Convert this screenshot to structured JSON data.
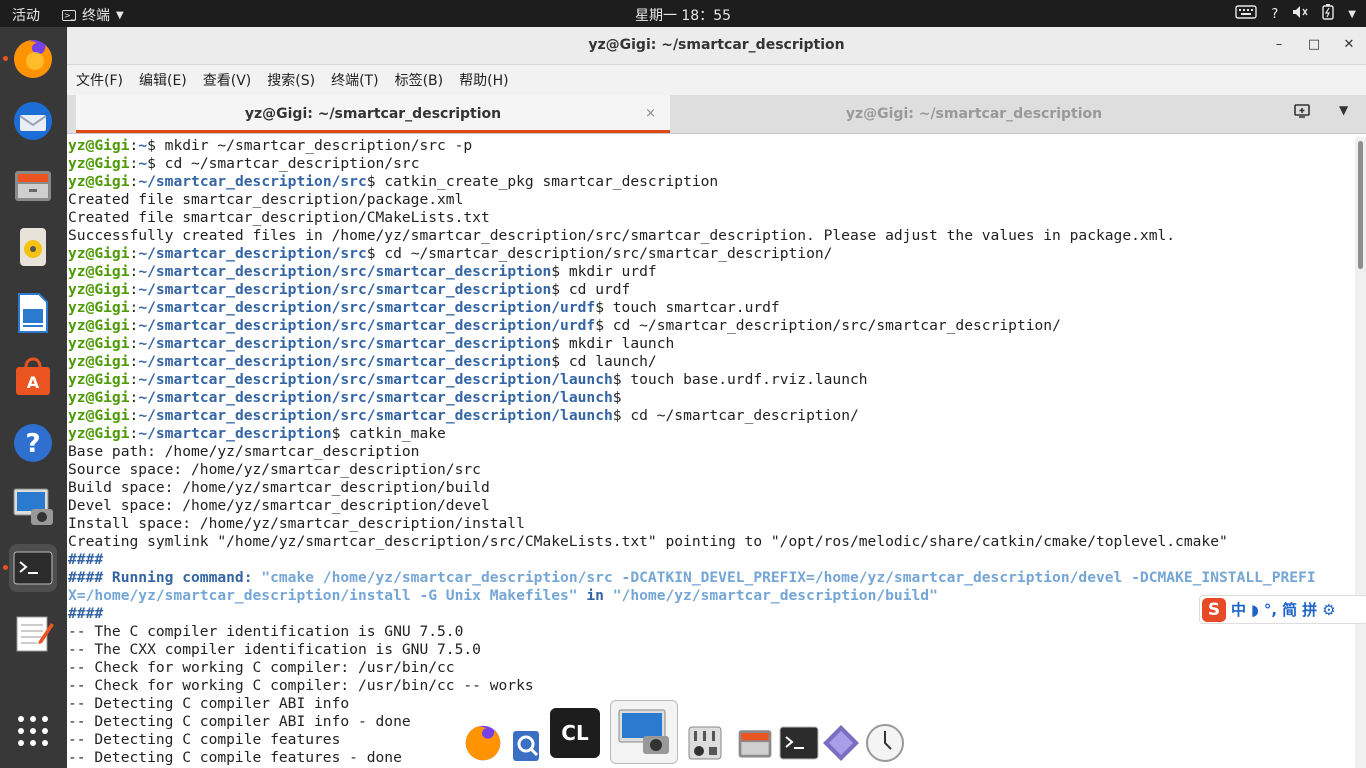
{
  "topbar": {
    "activities": "活动",
    "app_menu": "终端",
    "clock": "星期一 18：55",
    "tray": {
      "help": "?"
    }
  },
  "window": {
    "title": "yz@Gigi: ~/smartcar_description",
    "minimize": "–",
    "maximize": "□",
    "close": "✕"
  },
  "menubar": [
    "文件(F)",
    "编辑(E)",
    "查看(V)",
    "搜索(S)",
    "终端(T)",
    "标签(B)",
    "帮助(H)"
  ],
  "tabs": [
    {
      "label": "yz@Gigi: ~/smartcar_description",
      "close": "×"
    },
    {
      "label": "yz@Gigi: ~/smartcar_description",
      "close": "×"
    }
  ],
  "terminal": {
    "user": "yz@Gigi",
    "lines": [
      {
        "path": "~",
        "cmd": "mkdir ~/smartcar_description/src -p"
      },
      {
        "path": "~",
        "cmd": "cd ~/smartcar_description/src"
      },
      {
        "path": "~/smartcar_description/src",
        "cmd": "catkin_create_pkg smartcar_description"
      },
      {
        "text": "Created file smartcar_description/package.xml"
      },
      {
        "text": "Created file smartcar_description/CMakeLists.txt"
      },
      {
        "text": "Successfully created files in /home/yz/smartcar_description/src/smartcar_description. Please adjust the values in package.xml."
      },
      {
        "path": "~/smartcar_description/src",
        "cmd": "cd ~/smartcar_description/src/smartcar_description/"
      },
      {
        "path": "~/smartcar_description/src/smartcar_description",
        "cmd": "mkdir urdf"
      },
      {
        "path": "~/smartcar_description/src/smartcar_description",
        "cmd": "cd urdf"
      },
      {
        "path": "~/smartcar_description/src/smartcar_description/urdf",
        "cmd": "touch smartcar.urdf"
      },
      {
        "path": "~/smartcar_description/src/smartcar_description/urdf",
        "cmd": "cd ~/smartcar_description/src/smartcar_description/"
      },
      {
        "path": "~/smartcar_description/src/smartcar_description",
        "cmd": "mkdir launch"
      },
      {
        "path": "~/smartcar_description/src/smartcar_description",
        "cmd": "cd launch/"
      },
      {
        "path": "~/smartcar_description/src/smartcar_description/launch",
        "cmd": "touch base.urdf.rviz.launch"
      },
      {
        "path": "~/smartcar_description/src/smartcar_description/launch",
        "cmd": ""
      },
      {
        "path": "~/smartcar_description/src/smartcar_description/launch",
        "cmd": "cd ~/smartcar_description/"
      },
      {
        "path": "~/smartcar_description",
        "cmd": "catkin_make"
      },
      {
        "text": "Base path: /home/yz/smartcar_description"
      },
      {
        "text": "Source space: /home/yz/smartcar_description/src"
      },
      {
        "text": "Build space: /home/yz/smartcar_description/build"
      },
      {
        "text": "Devel space: /home/yz/smartcar_description/devel"
      },
      {
        "text": "Install space: /home/yz/smartcar_description/install"
      },
      {
        "text": "Creating symlink \"/home/yz/smartcar_description/src/CMakeLists.txt\" pointing to \"/opt/ros/melodic/share/catkin/cmake/toplevel.cmake\""
      },
      {
        "blue": "####"
      },
      {
        "runcmd": true,
        "prefix": "#### Running command: ",
        "q1": "\"cmake /home/yz/smartcar_description/src -DCATKIN_DEVEL_PREFIX=/home/yz/smartcar_description/devel -DCMAKE_INSTALL_PREFI"
      },
      {
        "runcmd2": true,
        "q1": "X=/home/yz/smartcar_description/install -G Unix Makefiles\"",
        "mid": " in ",
        "q2": "\"/home/yz/smartcar_description/build\""
      },
      {
        "blue": "####"
      },
      {
        "text": "-- The C compiler identification is GNU 7.5.0"
      },
      {
        "text": "-- The CXX compiler identification is GNU 7.5.0"
      },
      {
        "text": "-- Check for working C compiler: /usr/bin/cc"
      },
      {
        "text": "-- Check for working C compiler: /usr/bin/cc -- works"
      },
      {
        "text": "-- Detecting C compiler ABI info"
      },
      {
        "text": "-- Detecting C compiler ABI info - done"
      },
      {
        "text": "-- Detecting C compile features"
      },
      {
        "text": "-- Detecting C compile features - done"
      }
    ]
  },
  "ime": {
    "logo": "S",
    "items": [
      "中",
      "◗",
      "°,",
      "简",
      "拼",
      "⚙"
    ]
  },
  "float_dock": {
    "clion_label": "CL"
  },
  "colors": {
    "accent": "#e95420",
    "prompt_user": "#4e9a06",
    "prompt_path": "#3465a4"
  }
}
